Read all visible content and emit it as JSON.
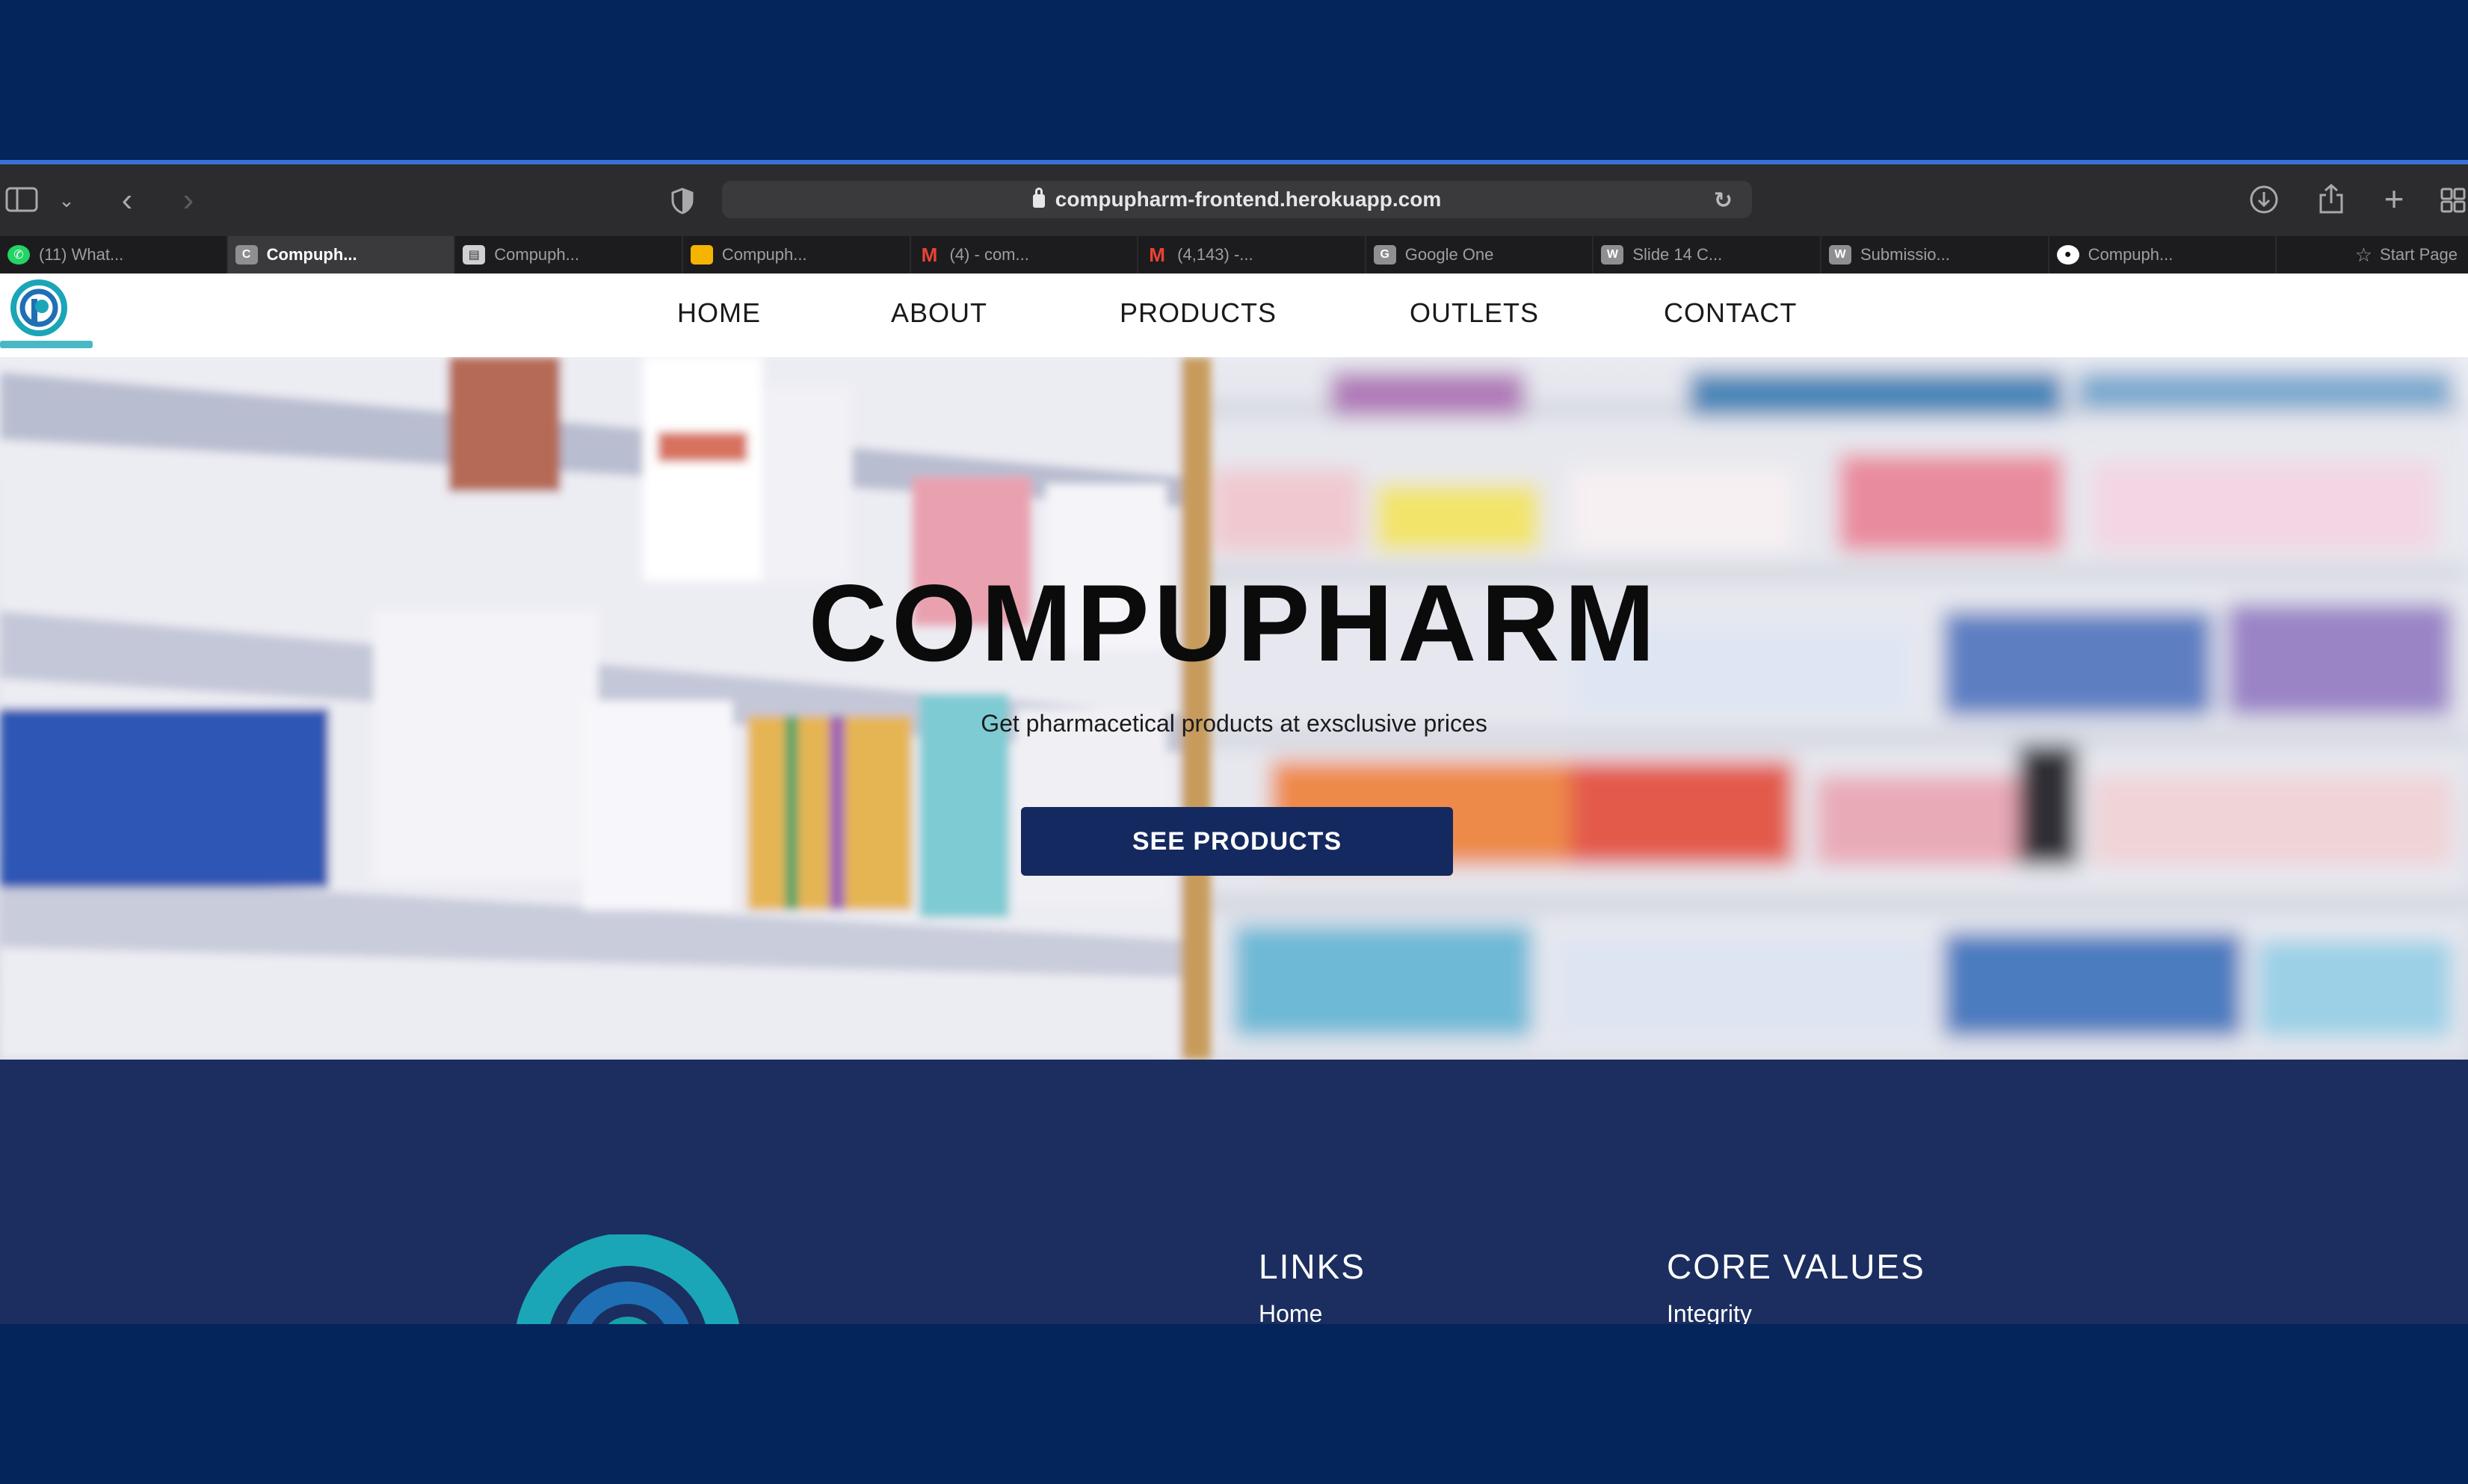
{
  "browser": {
    "url": "compupharm-frontend.herokuapp.com",
    "tabs": [
      {
        "label": "(11) What...",
        "icon": "whatsapp-icon",
        "color": "#25d366"
      },
      {
        "label": "Compuph...",
        "icon": "c-favicon-icon",
        "color": "#8e8e93",
        "active": true
      },
      {
        "label": "Compuph...",
        "icon": "slides-icon",
        "color": "#cfcfd4"
      },
      {
        "label": "Compuph...",
        "icon": "slides-yellow-icon",
        "color": "#f4b400"
      },
      {
        "label": "(4) - com...",
        "icon": "gmail-icon",
        "color": "#ea4335"
      },
      {
        "label": "(4,143) -...",
        "icon": "gmail-icon",
        "color": "#ea4335"
      },
      {
        "label": "Google One",
        "icon": "g-favicon-icon",
        "color": "#8e8e93"
      },
      {
        "label": "Slide 14 C...",
        "icon": "w-favicon-icon",
        "color": "#8e8e93"
      },
      {
        "label": "Submissio...",
        "icon": "w-favicon-icon",
        "color": "#8e8e93"
      },
      {
        "label": "Compuph...",
        "icon": "github-icon",
        "color": "#ffffff"
      }
    ],
    "start_page": "Start Page"
  },
  "nav": {
    "items": [
      "HOME",
      "ABOUT",
      "PRODUCTS",
      "OUTLETS",
      "CONTACT"
    ]
  },
  "hero": {
    "title": "COMPUPHARM",
    "subtitle": "Get pharmacetical products at exsclusive prices",
    "cta": "SEE PRODUCTS"
  },
  "footer": {
    "links_heading": "LINKS",
    "links": [
      "Home"
    ],
    "core_values_heading": "CORE VALUES",
    "core_values": [
      "Integrity"
    ]
  },
  "colors": {
    "page_bg": "#04255b",
    "brand_navy": "#14295f",
    "footer_bg": "#1b2e5f",
    "logo_teal": "#1aa6b7",
    "logo_blue": "#1f6fb5"
  }
}
